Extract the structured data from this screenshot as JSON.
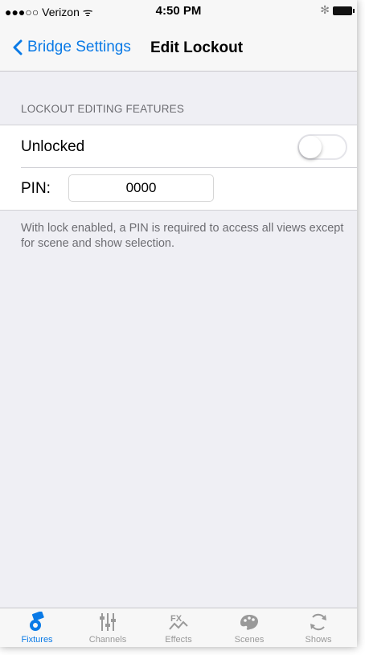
{
  "status_bar": {
    "carrier": "●●●○○ Verizon ᯤ",
    "time": "4:50 PM",
    "bluetooth": "✻"
  },
  "nav": {
    "back_label": "Bridge Settings",
    "title": "Edit Lockout"
  },
  "section": {
    "header": "LOCKOUT EDITING FEATURES"
  },
  "lock_row": {
    "label": "Unlocked",
    "toggle_on": false
  },
  "pin_row": {
    "label": "PIN:",
    "value": "0000"
  },
  "footer": {
    "text": "With lock enabled, a PIN is required to access all views except for scene and show selection."
  },
  "tabs": [
    {
      "label": "Fixtures",
      "icon": "fixtures-icon",
      "active": true
    },
    {
      "label": "Channels",
      "icon": "channels-icon",
      "active": false
    },
    {
      "label": "Effects",
      "icon": "effects-icon",
      "active": false
    },
    {
      "label": "Scenes",
      "icon": "scenes-icon",
      "active": false
    },
    {
      "label": "Shows",
      "icon": "shows-icon",
      "active": false
    }
  ],
  "colors": {
    "accent": "#0a7ae6",
    "inactive_tab": "#999999",
    "background": "#efeff4"
  }
}
